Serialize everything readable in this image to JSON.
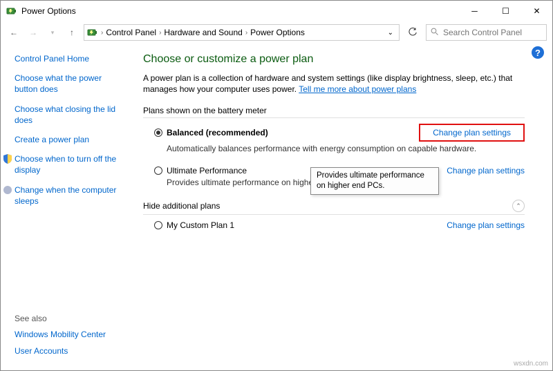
{
  "window": {
    "title": "Power Options"
  },
  "breadcrumb": {
    "items": [
      "Control Panel",
      "Hardware and Sound",
      "Power Options"
    ]
  },
  "search": {
    "placeholder": "Search Control Panel"
  },
  "sidebar": {
    "home": "Control Panel Home",
    "links": [
      "Choose what the power button does",
      "Choose what closing the lid does",
      "Create a power plan",
      "Choose when to turn off the display",
      "Change when the computer sleeps"
    ],
    "see_also_hdr": "See also",
    "see_also": [
      "Windows Mobility Center",
      "User Accounts"
    ]
  },
  "main": {
    "heading": "Choose or customize a power plan",
    "intro_a": "A power plan is a collection of hardware and system settings (like display brightness, sleep, etc.) that manages how your computer uses power. ",
    "intro_link": "Tell me more about power plans",
    "group1_hdr": "Plans shown on the battery meter",
    "plan1": {
      "name": "Balanced (recommended)",
      "desc": "Automatically balances performance with energy consumption on capable hardware.",
      "link": "Change plan settings"
    },
    "plan2": {
      "name": "Ultimate Performance",
      "desc": "Provides ultimate performance on higher en",
      "link": "Change plan settings"
    },
    "group2_hdr": "Hide additional plans",
    "plan3": {
      "name": "My Custom Plan 1",
      "link": "Change plan settings"
    },
    "tooltip": "Provides ultimate performance on higher end PCs."
  },
  "watermark": "wsxdn.com"
}
